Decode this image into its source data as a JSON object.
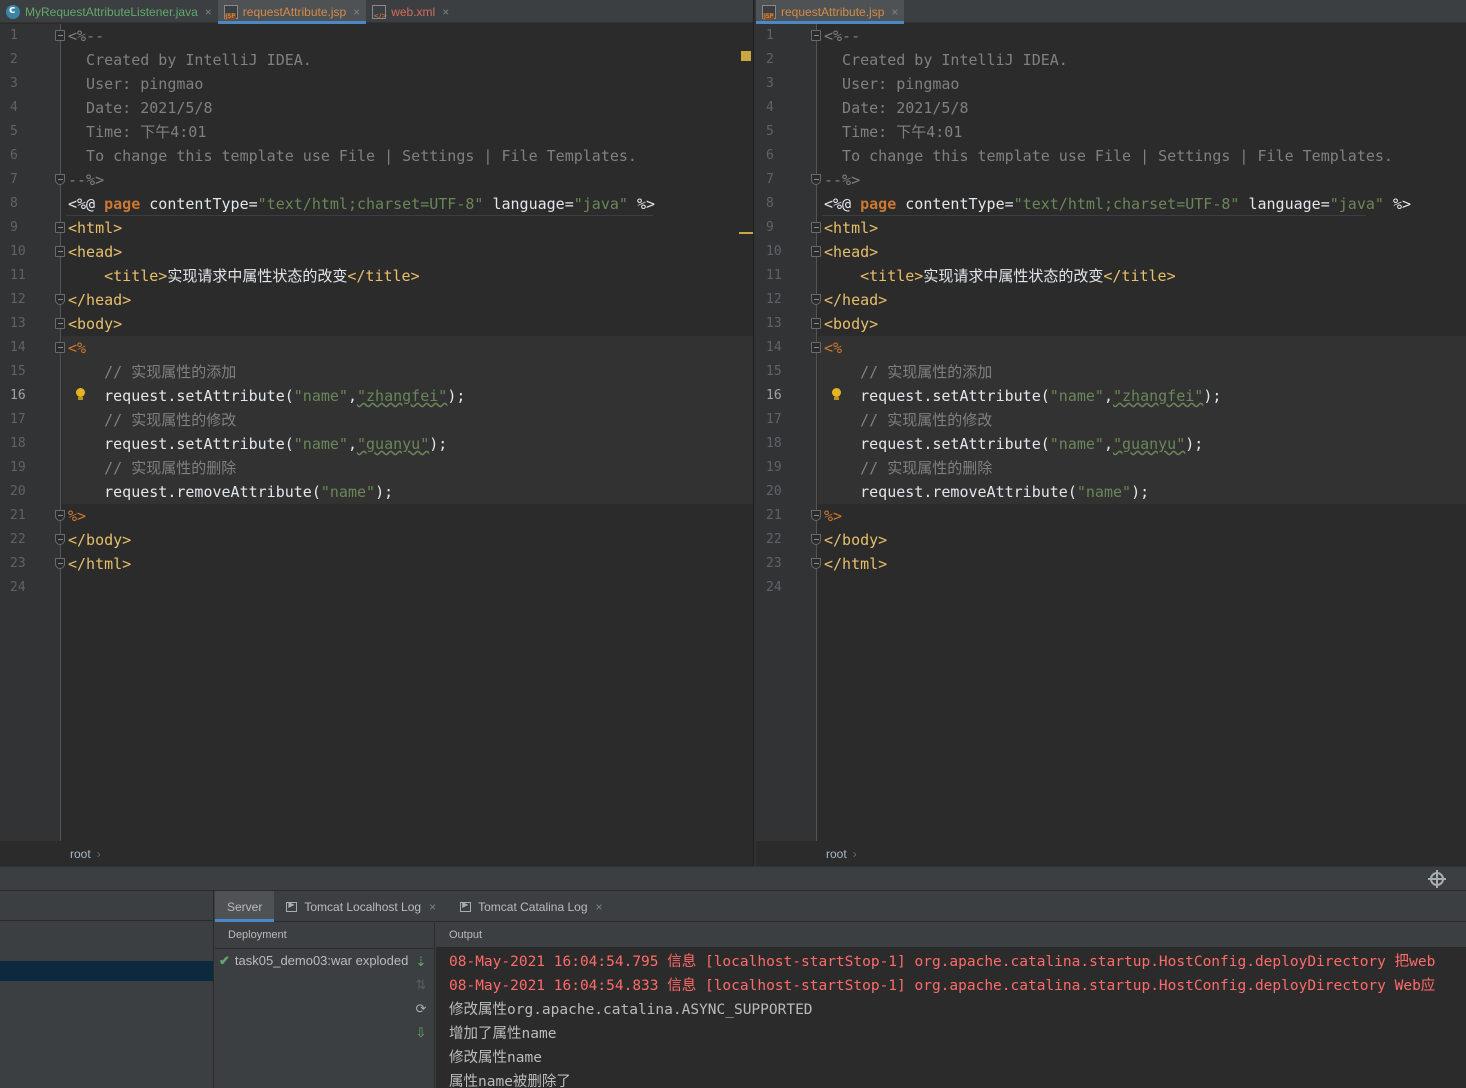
{
  "left_tabs": [
    {
      "label": "MyRequestAttributeListener.java",
      "icon": "java-class-icon",
      "color": "green"
    },
    {
      "label": "requestAttribute.jsp",
      "icon": "jsp-file-icon",
      "color": "orange",
      "active": true
    },
    {
      "label": "web.xml",
      "icon": "xml-file-icon",
      "color": "red"
    }
  ],
  "right_tabs": [
    {
      "label": "requestAttribute.jsp",
      "icon": "jsp-file-icon",
      "color": "orange",
      "active": true
    }
  ],
  "tab_close": "×",
  "code": {
    "line_numbers": [
      "1",
      "2",
      "3",
      "4",
      "5",
      "6",
      "7",
      "8",
      "9",
      "10",
      "11",
      "12",
      "13",
      "14",
      "15",
      "16",
      "17",
      "18",
      "19",
      "20",
      "21",
      "22",
      "23",
      "24"
    ],
    "current_line": "16",
    "comment_open": "<%--",
    "comment_created": "  Created by IntelliJ IDEA.",
    "comment_user": "  User: pingmao",
    "comment_date": "  Date: 2021/5/8",
    "comment_time": "  Time: 下午4:01",
    "comment_change": "  To change this template use File | Settings | File Templates.",
    "comment_close": "--%>",
    "directive_open": "<%@ ",
    "directive_kw": "page",
    "directive_attr1": " contentType=",
    "directive_val1": "\"text/html;charset=UTF-8\"",
    "directive_attr2": " language=",
    "directive_val2": "\"java\"",
    "directive_close": " %>",
    "html_open": "<html>",
    "head_open": "<head>",
    "title_indent": "    ",
    "title_open": "<title>",
    "title_text": "实现请求中属性状态的改变",
    "title_close": "</title>",
    "head_close": "</head>",
    "body_open": "<body>",
    "scriptlet_open": "<%",
    "comment_add": "    // 实现属性的添加",
    "set1_prefix": "    request.setAttribute(",
    "set1_arg1": "\"name\"",
    "comma": ",",
    "set1_arg2": "\"zhangfei\"",
    "set_suffix": ");",
    "comment_modify": "    // 实现属性的修改",
    "set2_prefix": "    request.setAttribute(",
    "set2_arg1": "\"name\"",
    "set2_arg2": "\"guanyu\"",
    "comment_delete": "    // 实现属性的删除",
    "remove_prefix": "    request.removeAttribute(",
    "remove_arg": "\"name\"",
    "scriptlet_close": "%>",
    "body_close": "</body>",
    "html_close": "</html>"
  },
  "breadcrumb": {
    "label": "root",
    "chevron": "›"
  },
  "services": {
    "tabs": [
      {
        "label": "Server",
        "active": true
      },
      {
        "label": "Tomcat Localhost Log"
      },
      {
        "label": "Tomcat Catalina Log"
      }
    ],
    "deployment_header": "Deployment",
    "deployment_item": "task05_demo03:war exploded",
    "output_header": "Output",
    "output_lines": [
      {
        "text": "08-May-2021 16:04:54.795 信息 [localhost-startStop-1] org.apache.catalina.startup.HostConfig.deployDirectory 把web",
        "type": "err"
      },
      {
        "text": "08-May-2021 16:04:54.833 信息 [localhost-startStop-1] org.apache.catalina.startup.HostConfig.deployDirectory Web应",
        "type": "err"
      },
      {
        "text": "修改属性org.apache.catalina.ASYNC_SUPPORTED",
        "type": "norm"
      },
      {
        "text": "增加了属性name",
        "type": "norm"
      },
      {
        "text": "修改属性name",
        "type": "norm"
      },
      {
        "text": "属性name被删除了",
        "type": "norm"
      }
    ]
  },
  "colors": {
    "editor_bg": "#2b2b2b",
    "gutter_bg": "#313335",
    "tag": "#e8bf6a",
    "keyword": "#cc7832",
    "string": "#6a8759",
    "comment": "#808080",
    "error_text": "#ff6b68",
    "accent": "#4a88c7"
  }
}
